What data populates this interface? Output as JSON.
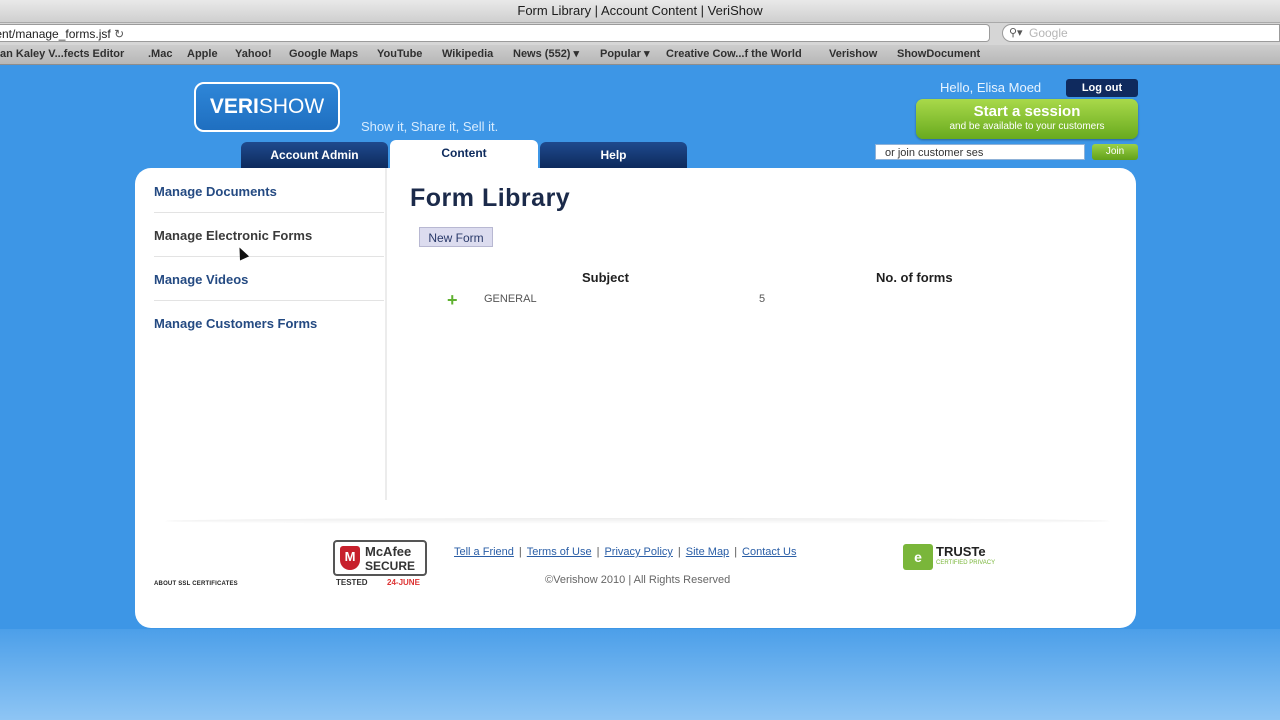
{
  "browser": {
    "title": "Form Library | Account Content | VeriShow",
    "url": "tent/manage_forms.jsf",
    "reload_icon": "reload-icon",
    "search_placeholder": "Google",
    "bookmarks": [
      "an Kaley V...fects Editor",
      ".Mac",
      "Apple",
      "Yahoo!",
      "Google Maps",
      "YouTube",
      "Wikipedia",
      "News (552) ▾",
      "Popular ▾",
      "Creative Cow...f the World",
      "Verishow",
      "ShowDocument"
    ]
  },
  "header": {
    "logo_a": "VERI",
    "logo_b": "SHOW",
    "tagline": "Show it, Share it, Sell it.",
    "greeting": "Hello, Elisa Moed",
    "logout": "Log out",
    "start_title": "Start a session",
    "start_sub": "and be available to your customers",
    "join_value": "or join customer ses",
    "join_button": "Join"
  },
  "tabs": [
    {
      "label": "Account Admin",
      "active": false
    },
    {
      "label": "Content",
      "active": true
    },
    {
      "label": "Help",
      "active": false
    }
  ],
  "sidebar": {
    "items": [
      {
        "label": "Manage Documents"
      },
      {
        "label": "Manage Electronic Forms",
        "current": true
      },
      {
        "label": "Manage Videos"
      },
      {
        "label": "Manage Customers Forms"
      }
    ]
  },
  "main": {
    "title": "Form Library",
    "new_form": "New Form",
    "columns": [
      "Subject",
      "No. of forms"
    ],
    "rows": [
      {
        "expand_icon": "plus-icon",
        "subject": "GENERAL",
        "count": "5"
      }
    ]
  },
  "footer": {
    "ssl": "ABOUT SSL CERTIFICATES",
    "mcafee_name": "McAfee",
    "mcafee_secure": "SECURE",
    "mcafee_tested": "TESTED",
    "mcafee_date": "24-JUNE",
    "links": [
      "Tell a Friend",
      "Terms of Use",
      "Privacy Policy",
      "Site Map",
      "Contact Us"
    ],
    "copyright": "©Verishow 2010 | All Rights Reserved",
    "truste": "TRUSTe",
    "truste_sub": "CERTIFIED PRIVACY"
  }
}
